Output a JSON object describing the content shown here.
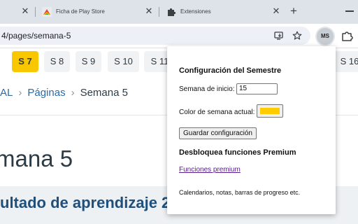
{
  "tabs": [
    {
      "title": "Ficha de Play Store",
      "icon": "play-store-favicon"
    },
    {
      "title": "Extensiones",
      "icon": "puzzle-favicon"
    }
  ],
  "address_bar": {
    "url": "4/pages/semana-5"
  },
  "profile": {
    "initials": "MS"
  },
  "weeks": {
    "items": [
      "S 7",
      "S 8",
      "S 9",
      "S 10",
      "S 11",
      "S 16"
    ],
    "active": "S 7"
  },
  "breadcrumb": {
    "parent": "AL",
    "section": "Páginas",
    "current": "Semana 5"
  },
  "page": {
    "title": "mana 5",
    "section_heading": "ultado de aprendizaje 2"
  },
  "popup": {
    "title": "Configuración del Semestre",
    "start_week_label": "Semana de inicio:",
    "start_week_value": "15",
    "color_label": "Color de semana actual:",
    "color_value": "#ffcc00",
    "save_label": "Guardar configuración",
    "premium_heading": "Desbloquea funciones Premium",
    "premium_link": "Funciones premium",
    "premium_note": "Calendarios, notas, barras de progreso etc."
  },
  "colors": {
    "accent": "#f8c700",
    "link": "#2b6aa8",
    "heading": "#1f4f7a"
  }
}
